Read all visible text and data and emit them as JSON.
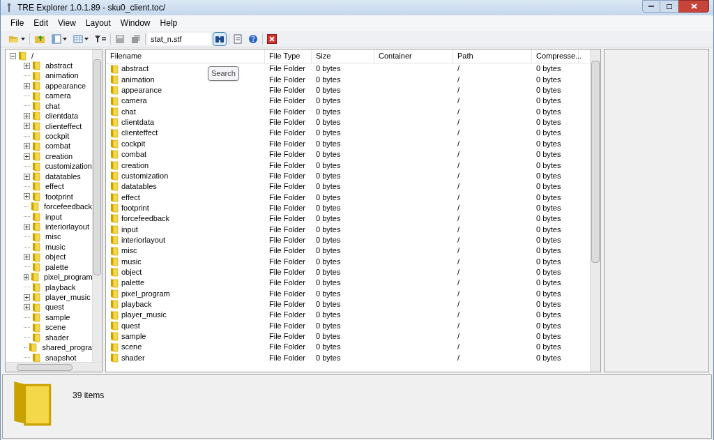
{
  "window": {
    "title": "TRE Explorer 1.0.1.89 - sku0_client.toc/"
  },
  "menu": [
    "File",
    "Edit",
    "View",
    "Layout",
    "Window",
    "Help"
  ],
  "toolbar": {
    "search_value": "stat_n.stf",
    "search_active": true
  },
  "tree": {
    "label": "/",
    "expanded": true,
    "children": [
      {
        "label": "abstract",
        "expandable": true
      },
      {
        "label": "animation",
        "expandable": false
      },
      {
        "label": "appearance",
        "expandable": true
      },
      {
        "label": "camera",
        "expandable": false
      },
      {
        "label": "chat",
        "expandable": false
      },
      {
        "label": "clientdata",
        "expandable": true
      },
      {
        "label": "clienteffect",
        "expandable": true
      },
      {
        "label": "cockpit",
        "expandable": false
      },
      {
        "label": "combat",
        "expandable": true
      },
      {
        "label": "creation",
        "expandable": true
      },
      {
        "label": "customization",
        "expandable": false
      },
      {
        "label": "datatables",
        "expandable": true
      },
      {
        "label": "effect",
        "expandable": false
      },
      {
        "label": "footprint",
        "expandable": true
      },
      {
        "label": "forcefeedback",
        "expandable": false
      },
      {
        "label": "input",
        "expandable": false
      },
      {
        "label": "interiorlayout",
        "expandable": true
      },
      {
        "label": "misc",
        "expandable": false
      },
      {
        "label": "music",
        "expandable": false
      },
      {
        "label": "object",
        "expandable": true
      },
      {
        "label": "palette",
        "expandable": false
      },
      {
        "label": "pixel_program",
        "expandable": true
      },
      {
        "label": "playback",
        "expandable": false
      },
      {
        "label": "player_music",
        "expandable": true
      },
      {
        "label": "quest",
        "expandable": true
      },
      {
        "label": "sample",
        "expandable": false
      },
      {
        "label": "scene",
        "expandable": false
      },
      {
        "label": "shader",
        "expandable": false
      },
      {
        "label": "shared_progra",
        "expandable": false
      },
      {
        "label": "snapshot",
        "expandable": false
      }
    ]
  },
  "table": {
    "columns": [
      "Filename",
      "File Type",
      "Size",
      "Container",
      "Path",
      "Compresse..."
    ],
    "rows": [
      {
        "filename": "abstract",
        "file_type": "File Folder",
        "size": "0 bytes",
        "path": "/",
        "compressed": "0 bytes"
      },
      {
        "filename": "animation",
        "file_type": "File Folder",
        "size": "0 bytes",
        "path": "/",
        "compressed": "0 bytes"
      },
      {
        "filename": "appearance",
        "file_type": "File Folder",
        "size": "0 bytes",
        "path": "/",
        "compressed": "0 bytes"
      },
      {
        "filename": "camera",
        "file_type": "File Folder",
        "size": "0 bytes",
        "path": "/",
        "compressed": "0 bytes"
      },
      {
        "filename": "chat",
        "file_type": "File Folder",
        "size": "0 bytes",
        "path": "/",
        "compressed": "0 bytes"
      },
      {
        "filename": "clientdata",
        "file_type": "File Folder",
        "size": "0 bytes",
        "path": "/",
        "compressed": "0 bytes"
      },
      {
        "filename": "clienteffect",
        "file_type": "File Folder",
        "size": "0 bytes",
        "path": "/",
        "compressed": "0 bytes"
      },
      {
        "filename": "cockpit",
        "file_type": "File Folder",
        "size": "0 bytes",
        "path": "/",
        "compressed": "0 bytes"
      },
      {
        "filename": "combat",
        "file_type": "File Folder",
        "size": "0 bytes",
        "path": "/",
        "compressed": "0 bytes"
      },
      {
        "filename": "creation",
        "file_type": "File Folder",
        "size": "0 bytes",
        "path": "/",
        "compressed": "0 bytes"
      },
      {
        "filename": "customization",
        "file_type": "File Folder",
        "size": "0 bytes",
        "path": "/",
        "compressed": "0 bytes"
      },
      {
        "filename": "datatables",
        "file_type": "File Folder",
        "size": "0 bytes",
        "path": "/",
        "compressed": "0 bytes"
      },
      {
        "filename": "effect",
        "file_type": "File Folder",
        "size": "0 bytes",
        "path": "/",
        "compressed": "0 bytes"
      },
      {
        "filename": "footprint",
        "file_type": "File Folder",
        "size": "0 bytes",
        "path": "/",
        "compressed": "0 bytes"
      },
      {
        "filename": "forcefeedback",
        "file_type": "File Folder",
        "size": "0 bytes",
        "path": "/",
        "compressed": "0 bytes"
      },
      {
        "filename": "input",
        "file_type": "File Folder",
        "size": "0 bytes",
        "path": "/",
        "compressed": "0 bytes"
      },
      {
        "filename": "interiorlayout",
        "file_type": "File Folder",
        "size": "0 bytes",
        "path": "/",
        "compressed": "0 bytes"
      },
      {
        "filename": "misc",
        "file_type": "File Folder",
        "size": "0 bytes",
        "path": "/",
        "compressed": "0 bytes"
      },
      {
        "filename": "music",
        "file_type": "File Folder",
        "size": "0 bytes",
        "path": "/",
        "compressed": "0 bytes"
      },
      {
        "filename": "object",
        "file_type": "File Folder",
        "size": "0 bytes",
        "path": "/",
        "compressed": "0 bytes"
      },
      {
        "filename": "palette",
        "file_type": "File Folder",
        "size": "0 bytes",
        "path": "/",
        "compressed": "0 bytes"
      },
      {
        "filename": "pixel_program",
        "file_type": "File Folder",
        "size": "0 bytes",
        "path": "/",
        "compressed": "0 bytes"
      },
      {
        "filename": "playback",
        "file_type": "File Folder",
        "size": "0 bytes",
        "path": "/",
        "compressed": "0 bytes"
      },
      {
        "filename": "player_music",
        "file_type": "File Folder",
        "size": "0 bytes",
        "path": "/",
        "compressed": "0 bytes"
      },
      {
        "filename": "quest",
        "file_type": "File Folder",
        "size": "0 bytes",
        "path": "/",
        "compressed": "0 bytes"
      },
      {
        "filename": "sample",
        "file_type": "File Folder",
        "size": "0 bytes",
        "path": "/",
        "compressed": "0 bytes"
      },
      {
        "filename": "scene",
        "file_type": "File Folder",
        "size": "0 bytes",
        "path": "/",
        "compressed": "0 bytes"
      },
      {
        "filename": "shader",
        "file_type": "File Folder",
        "size": "0 bytes",
        "path": "/",
        "compressed": "0 bytes"
      }
    ]
  },
  "tooltip": "Search",
  "status": {
    "count": "39 items"
  }
}
